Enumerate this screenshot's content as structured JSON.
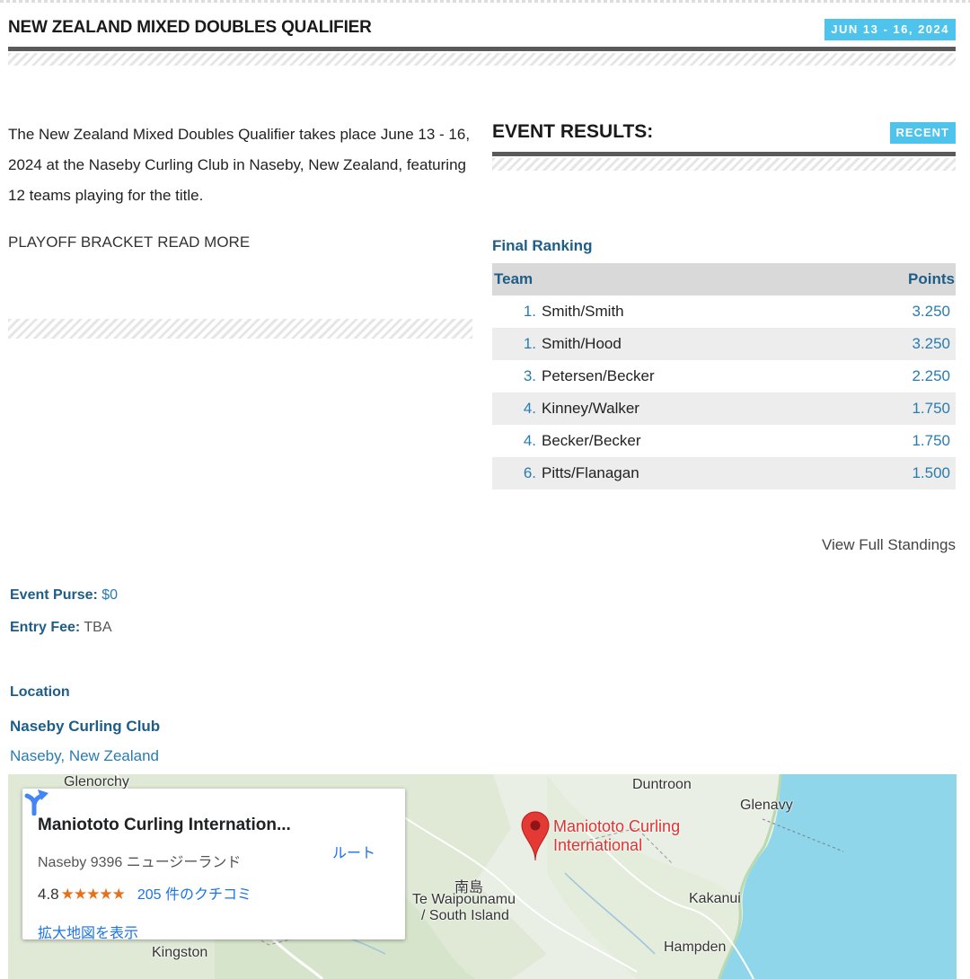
{
  "header": {
    "title": "NEW ZEALAND MIXED DOUBLES QUALIFIER",
    "date": "JUN 13 - 16, 2024"
  },
  "intro": {
    "text": "The New Zealand Mixed Doubles Qualifier takes place June 13 - 16, 2024 at the Naseby Curling Club in Naseby, New Zealand, featuring 12 teams playing for the title.",
    "links": [
      "PLAYOFF BRACKET",
      "READ MORE"
    ]
  },
  "results": {
    "title": "EVENT RESULTS:",
    "badge": "RECENT",
    "subtitle": "Final Ranking",
    "col_team": "Team",
    "col_points": "Points",
    "rows": [
      {
        "rank": "1.",
        "team": "Smith/Smith",
        "points": "3.250"
      },
      {
        "rank": "1.",
        "team": "Smith/Hood",
        "points": "3.250"
      },
      {
        "rank": "3.",
        "team": "Petersen/Becker",
        "points": "2.250"
      },
      {
        "rank": "4.",
        "team": "Kinney/Walker",
        "points": "1.750"
      },
      {
        "rank": "4.",
        "team": "Becker/Becker",
        "points": "1.750"
      },
      {
        "rank": "6.",
        "team": "Pitts/Flanagan",
        "points": "1.500"
      }
    ],
    "full_standings": "View Full Standings"
  },
  "event": {
    "purse_label": "Event Purse:",
    "purse_value": "$0",
    "fee_label": "Entry Fee:",
    "fee_value": "TBA"
  },
  "location": {
    "heading": "Location",
    "club": "Naseby Curling Club",
    "city": "Naseby, New Zealand"
  },
  "map": {
    "places": [
      "Glenorchy",
      "Duntroon",
      "Glenavy",
      "南島",
      "Te Waipounamu",
      "/ South Island",
      "Kakanui",
      "Kingston",
      "Hampden"
    ],
    "pin_label_1": "Maniototo Curling",
    "pin_label_2": "International",
    "card": {
      "title": "Maniototo Curling Internation...",
      "address": "Naseby 9396 ニュージーランド",
      "rating": "4.8",
      "stars": "★★★★★",
      "reviews": "205 件のクチコミ",
      "route": "ルート",
      "view_larger": "拡大地図を表示"
    },
    "colors": {
      "water": "#8fd6ea",
      "land": "#e9efe4",
      "pin": "#e53935"
    }
  }
}
